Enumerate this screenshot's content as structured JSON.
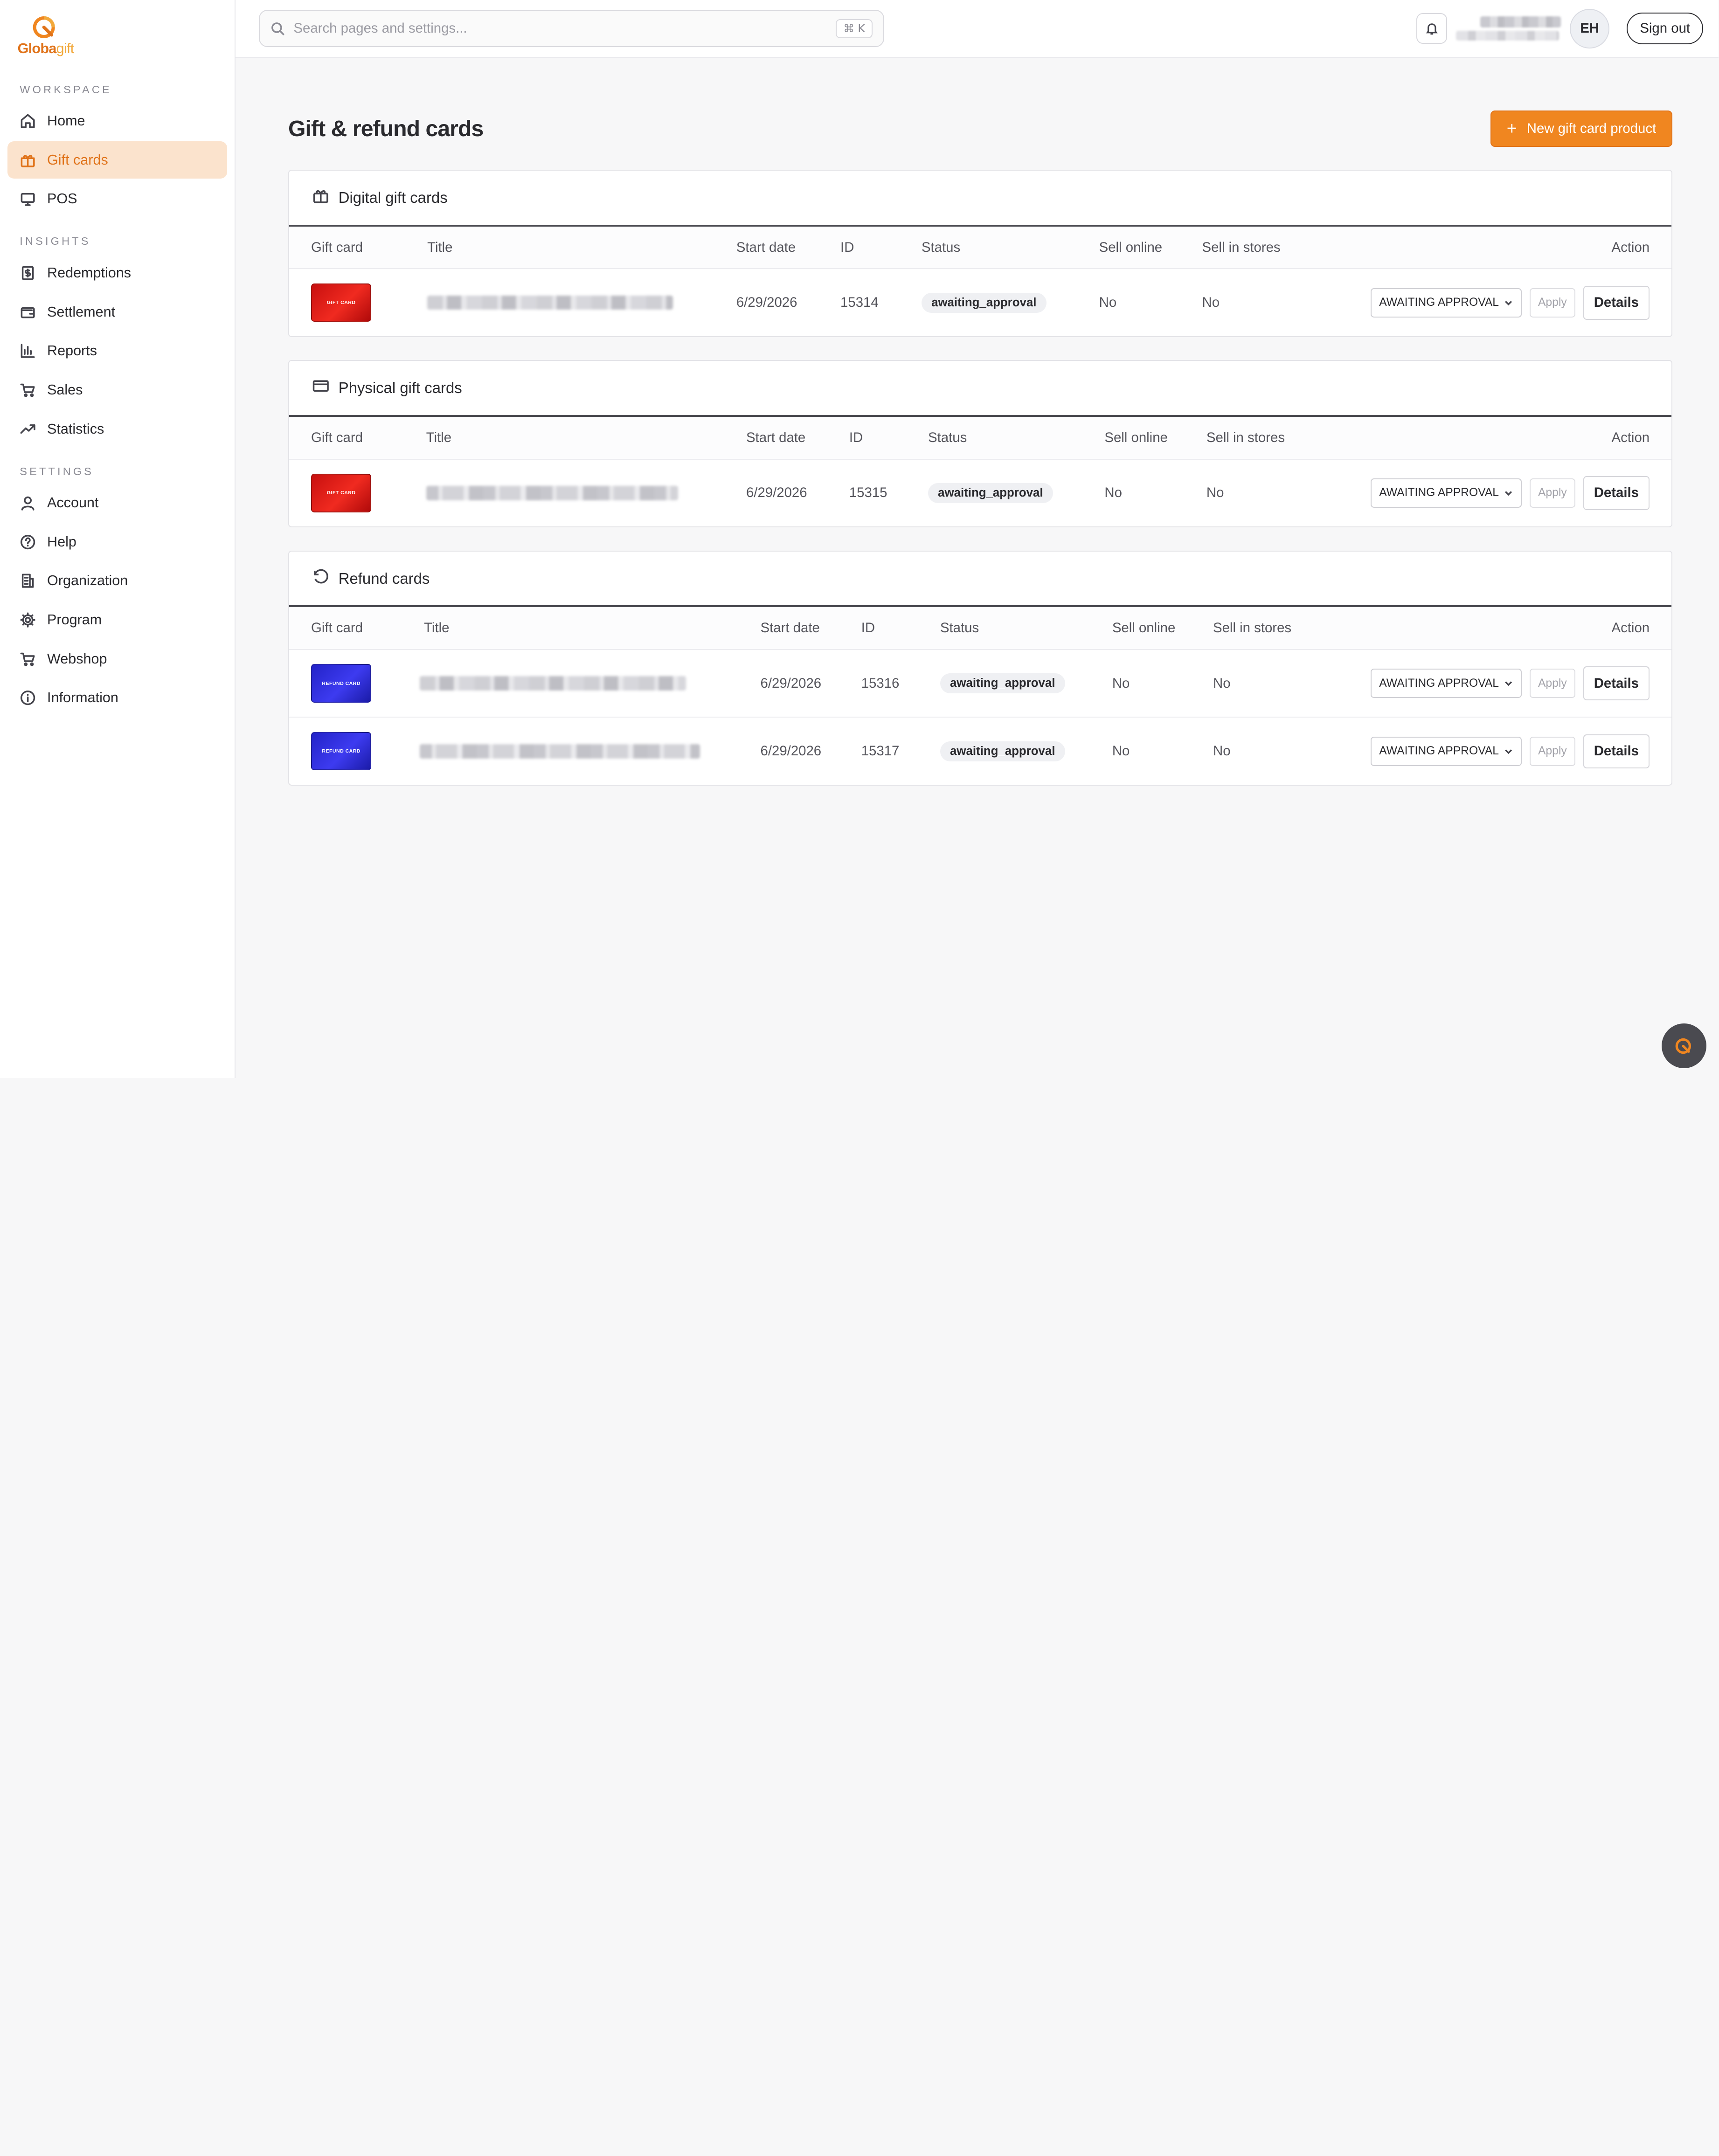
{
  "brand": {
    "name_part1": "Globa",
    "name_part2": "gift",
    "accent_color": "#f08620"
  },
  "sidebar": {
    "sections": [
      {
        "label": "WORKSPACE",
        "items": [
          {
            "label": "Home",
            "icon": "home-icon",
            "active": false
          },
          {
            "label": "Gift cards",
            "icon": "gift-icon",
            "active": true
          },
          {
            "label": "POS",
            "icon": "monitor-icon",
            "active": false
          }
        ]
      },
      {
        "label": "INSIGHTS",
        "items": [
          {
            "label": "Redemptions",
            "icon": "dollar-receipt-icon",
            "active": false
          },
          {
            "label": "Settlement",
            "icon": "wallet-icon",
            "active": false
          },
          {
            "label": "Reports",
            "icon": "bar-chart-icon",
            "active": false
          },
          {
            "label": "Sales",
            "icon": "cart-icon",
            "active": false
          },
          {
            "label": "Statistics",
            "icon": "trend-up-icon",
            "active": false
          }
        ]
      },
      {
        "label": "SETTINGS",
        "items": [
          {
            "label": "Account",
            "icon": "user-icon",
            "active": false
          },
          {
            "label": "Help",
            "icon": "help-circle-icon",
            "active": false
          },
          {
            "label": "Organization",
            "icon": "building-icon",
            "active": false
          },
          {
            "label": "Program",
            "icon": "gear-icon",
            "active": false
          },
          {
            "label": "Webshop",
            "icon": "cart-icon",
            "active": false
          },
          {
            "label": "Information",
            "icon": "info-icon",
            "active": false
          }
        ]
      }
    ]
  },
  "topbar": {
    "search_placeholder": "Search pages and settings...",
    "search_shortcut": "⌘ K",
    "avatar_initials": "EH",
    "signout_label": "Sign out"
  },
  "page": {
    "title": "Gift & refund cards",
    "new_button_label": "New gift card product"
  },
  "columns": {
    "gift_card": "Gift card",
    "title": "Title",
    "start_date": "Start date",
    "id": "ID",
    "status": "Status",
    "sell_online": "Sell online",
    "sell_in_stores": "Sell in stores",
    "action": "Action"
  },
  "sections": {
    "digital": {
      "title": "Digital gift cards",
      "rows": [
        {
          "thumb_label": "GIFT CARD",
          "start_date": "6/29/2026",
          "id": "15314",
          "status": "awaiting_approval",
          "sell_online": "No",
          "sell_in_stores": "No",
          "select_value": "AWAITING APPROVAL",
          "apply": "Apply",
          "details": "Details"
        }
      ]
    },
    "physical": {
      "title": "Physical gift cards",
      "rows": [
        {
          "thumb_label": "GIFT CARD",
          "start_date": "6/29/2026",
          "id": "15315",
          "status": "awaiting_approval",
          "sell_online": "No",
          "sell_in_stores": "No",
          "select_value": "AWAITING APPROVAL",
          "apply": "Apply",
          "details": "Details"
        }
      ]
    },
    "refund": {
      "title": "Refund cards",
      "rows": [
        {
          "thumb_label": "REFUND CARD",
          "start_date": "6/29/2026",
          "id": "15316",
          "status": "awaiting_approval",
          "sell_online": "No",
          "sell_in_stores": "No",
          "select_value": "AWAITING APPROVAL",
          "apply": "Apply",
          "details": "Details"
        },
        {
          "thumb_label": "REFUND CARD",
          "start_date": "6/29/2026",
          "id": "15317",
          "status": "awaiting_approval",
          "sell_online": "No",
          "sell_in_stores": "No",
          "select_value": "AWAITING APPROVAL",
          "apply": "Apply",
          "details": "Details"
        }
      ]
    }
  }
}
